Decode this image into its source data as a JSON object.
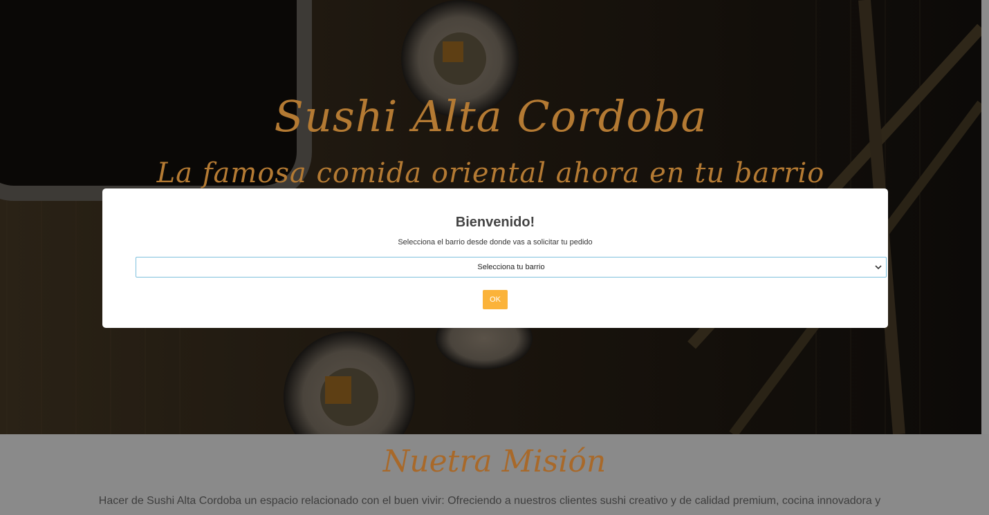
{
  "hero": {
    "title": "Sushi Alta Cordoba",
    "subtitle": "La famosa comida oriental ahora en tu barrio"
  },
  "mission": {
    "title": "Nuetra Misión",
    "text": "Hacer de Sushi Alta Cordoba un espacio relacionado con el buen vivir: Ofreciendo a nuestros clientes sushi creativo y de calidad premium, cocina innovadora y"
  },
  "modal": {
    "title": "Bienvenido!",
    "message": "Selecciona el barrio desde donde vas a solicitar tu pedido",
    "select_value": "Selecciona tu barrio",
    "ok_label": "OK"
  },
  "icons": {
    "select_arrow": "chevron-down-icon"
  },
  "colors": {
    "brand_script": "#b47a33",
    "ok_button": "#fbb33a",
    "select_border": "#7ec0dd"
  }
}
